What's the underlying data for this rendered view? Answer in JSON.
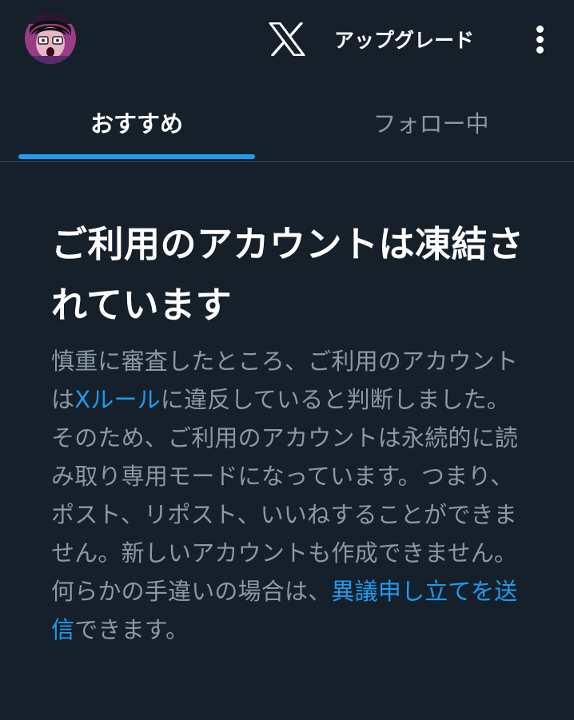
{
  "header": {
    "upgrade_label": "アップグレード",
    "logo_icon": "x-logo-icon",
    "more_icon": "more-vertical-icon",
    "avatar_icon": "avatar-image"
  },
  "tabs": [
    {
      "label": "おすすめ",
      "selected": true
    },
    {
      "label": "フォロー中",
      "selected": false
    }
  ],
  "notice": {
    "title": "ご利用のアカウントは凍結されています",
    "body_part1": "慎重に審査したところ、ご利用のアカウントは",
    "rules_link": "Xルール",
    "body_part2": "に違反していると判断しました。そのため、ご利用のアカウントは永続的に読み取り専用モードになっています。つまり、ポスト、リポスト、いいねすることができません。新しいアカウントも作成できません。何らかの手違いの場合は、",
    "appeal_link": "異議申し立てを送信",
    "body_part3": "できます。"
  },
  "colors": {
    "background": "#15202b",
    "accent": "#1d9bf0",
    "text_primary": "#ffffff",
    "text_secondary": "#8b98a5",
    "divider": "#38444d"
  }
}
